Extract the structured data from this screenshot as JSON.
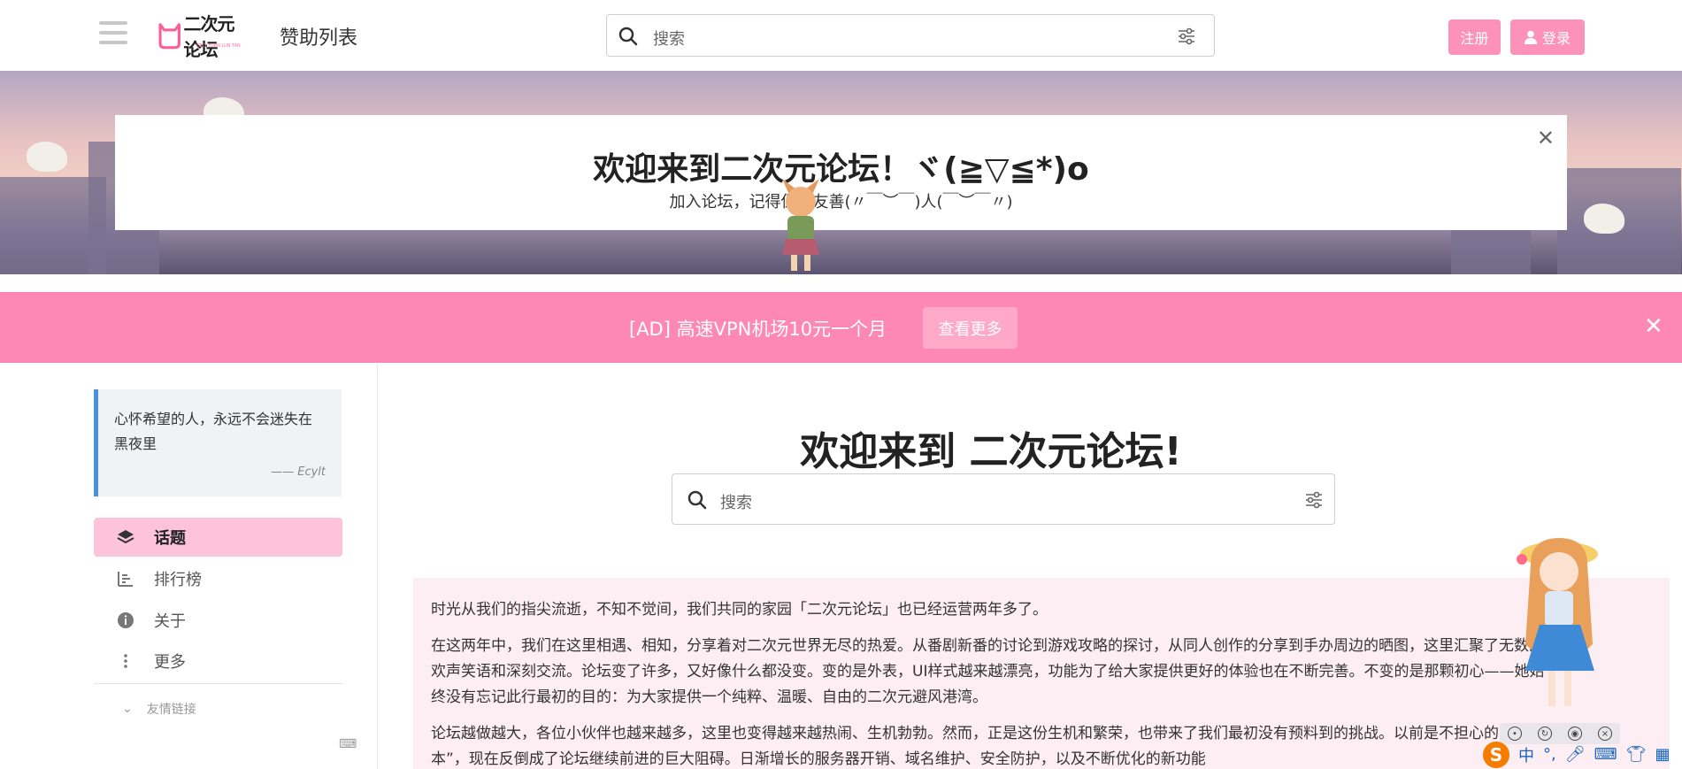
{
  "header": {
    "logo_text": "二次元论坛",
    "logo_sub": "ERCI YUAN LUN TAN",
    "nav_title": "赞助列表",
    "search_placeholder": "搜索",
    "register_label": "注册",
    "login_label": "登录"
  },
  "hero": {
    "title": "欢迎来到二次元论坛！ヾ(≧▽≦*)o",
    "subtitle": "加入论坛，记得保持友善(〃￣︶￣)人(￣︶￣〃)"
  },
  "ad": {
    "text": "[AD] 高速VPN机场10元一个月",
    "button": "查看更多"
  },
  "sidebar": {
    "quote": "心怀希望的人，永远不会迷失在黑夜里",
    "quote_author": "—— Ecylt",
    "items": [
      {
        "label": "话题",
        "icon": "layers-icon"
      },
      {
        "label": "排行榜",
        "icon": "ranking-icon"
      },
      {
        "label": "关于",
        "icon": "info-icon"
      },
      {
        "label": "更多",
        "icon": "more-vertical-icon"
      }
    ],
    "friend_links": "友情链接"
  },
  "main": {
    "title": "欢迎来到 二次元论坛!",
    "search_placeholder": "搜索",
    "paragraphs": [
      "时光从我们的指尖流逝，不知不觉间，我们共同的家园「二次元论坛」也已经运营两年多了。",
      "在这两年中，我们在这里相遇、相知，分享着对二次元世界无尽的热爱。从番剧新番的讨论到游戏攻略的探讨，从同人创作的分享到手办周边的晒图，这里汇聚了无数的欢声笑语和深刻交流。论坛变了许多，又好像什么都没变。变的是外表，UI样式越来越漂亮，功能为了给大家提供更好的体验也在不断完善。不变的是那颗初心——她始终没有忘记此行最初的目的：为大家提供一个纯粹、温暖、自由的二次元避风港湾。",
      "论坛越做越大，各位小伙伴也越来越多，这里也变得越来越热闹、生机勃勃。然而，正是这份生机和繁荣，也带来了我们最初没有预料到的挑战。以前是不担心的“成本”，现在反倒成了论坛继续前进的巨大阻碍。日渐增长的服务器开销、域名维护、安全防护，以及不断优化的新功能"
    ]
  },
  "ime": {
    "mode": "中",
    "punct": "°,"
  },
  "colors": {
    "accent_pink": "#fd92b9",
    "ad_pink": "#fd88b5",
    "active_nav": "#fdc3d9",
    "intro_bg": "#fdeef3",
    "quote_border": "#4a90e2"
  }
}
